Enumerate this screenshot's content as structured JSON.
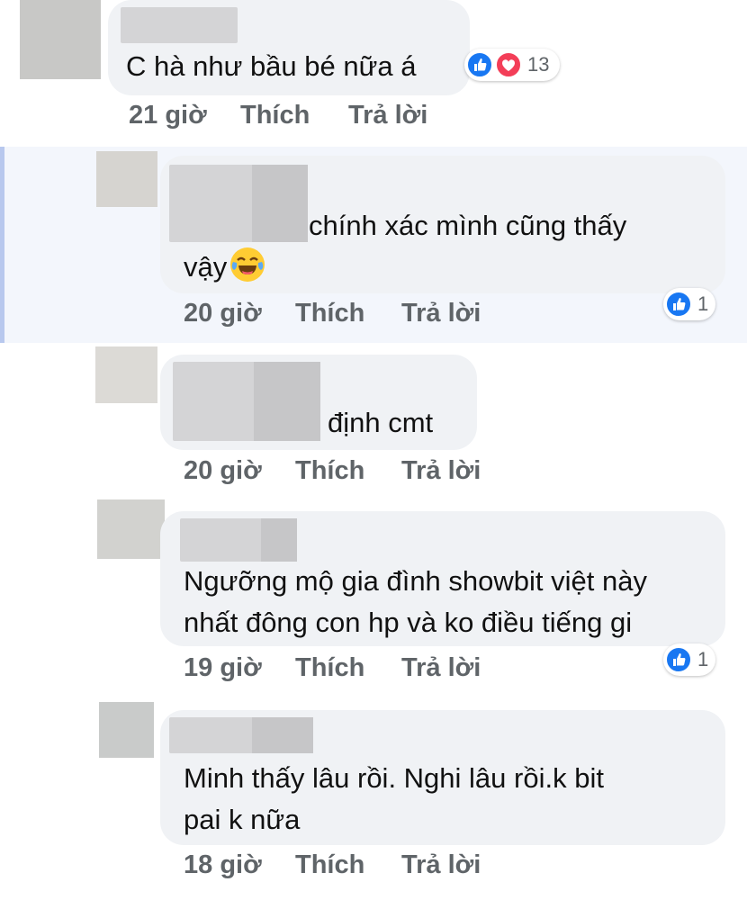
{
  "comments": [
    {
      "text_lines": [
        "C hà như bầu bé nữa á"
      ],
      "time": "21 giờ",
      "like_label": "Thích",
      "reply_label": "Trả lời",
      "reaction_count": "13",
      "reactions": [
        "like-icon",
        "love-icon"
      ]
    },
    {
      "text_lines": [
        "chính xác mình cũng thấy",
        "vậy"
      ],
      "emoji": "laughing-tears-emoji",
      "time": "20 giờ",
      "like_label": "Thích",
      "reply_label": "Trả lời",
      "reaction_count": "1",
      "reactions": [
        "like-icon"
      ]
    },
    {
      "text_lines": [
        "định cmt"
      ],
      "time": "20 giờ",
      "like_label": "Thích",
      "reply_label": "Trả lời"
    },
    {
      "text_lines": [
        "Ngưỡng mộ gia đình showbit việt này",
        "nhất đông con hp và ko điều tiếng gi"
      ],
      "time": "19 giờ",
      "like_label": "Thích",
      "reply_label": "Trả lời",
      "reaction_count": "1",
      "reactions": [
        "like-icon"
      ]
    },
    {
      "text_lines": [
        "Minh thấy lâu rồi. Nghi lâu rồi.k bit",
        "pai k nữa"
      ],
      "time": "18 giờ",
      "like_label": "Thích",
      "reply_label": "Trả lời"
    }
  ],
  "colors": {
    "bubble": "#f0f2f5",
    "like_blue": "#1877f2",
    "love_red": "#f33e58",
    "meta_gray": "#5f6468",
    "highlight": "#f3f6fc"
  }
}
